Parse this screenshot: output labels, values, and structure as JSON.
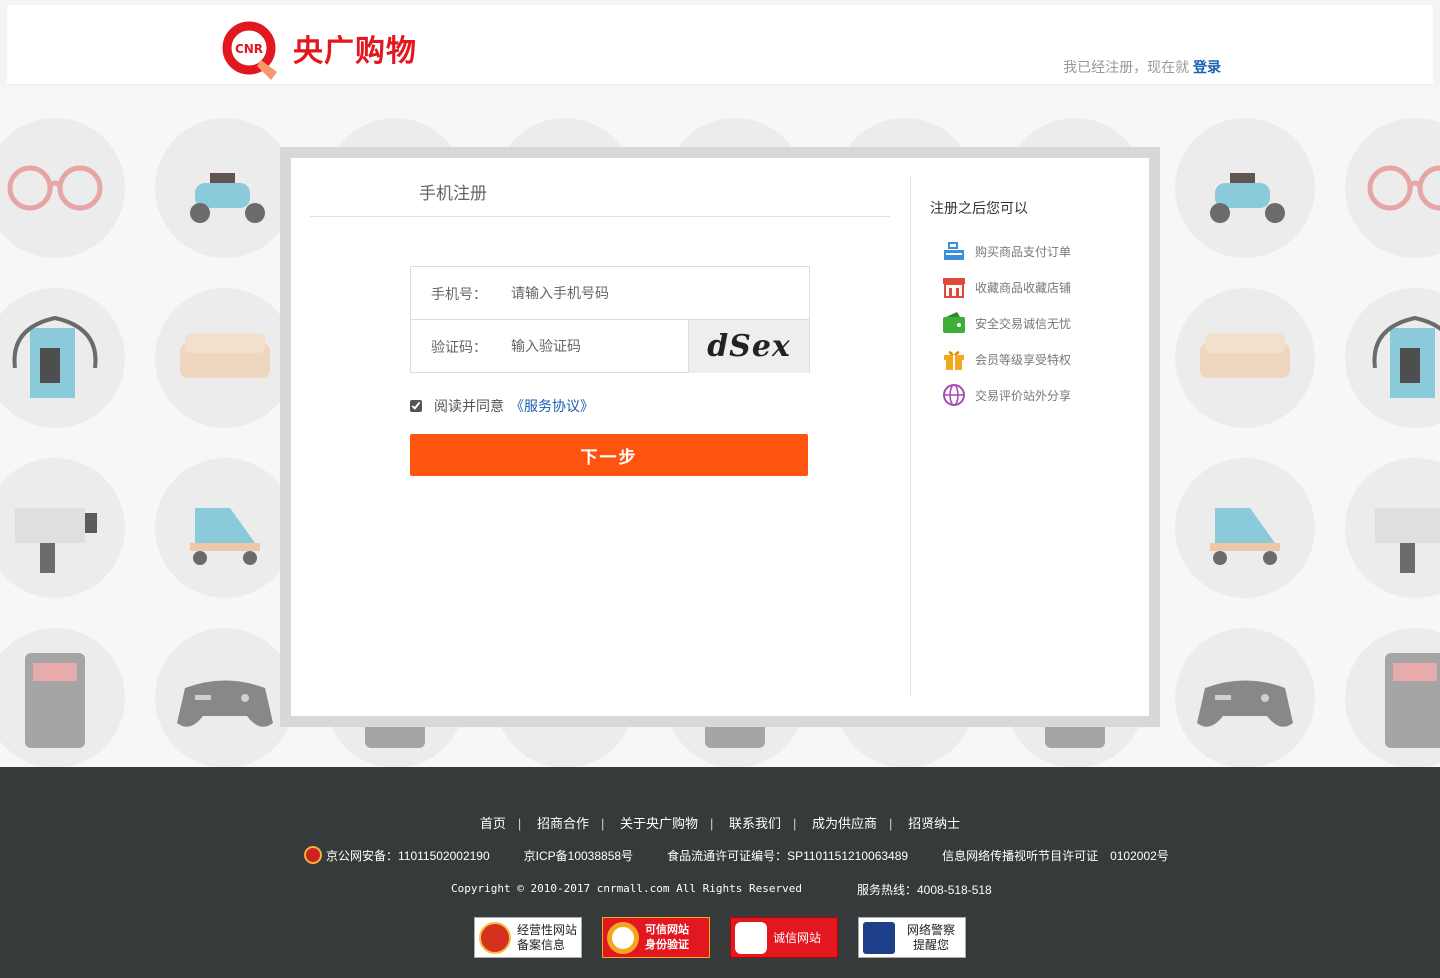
{
  "header": {
    "logo_badge": "CNR",
    "logo_text": "央广购物",
    "login_prefix": "我已经注册，现在就",
    "login_link": "登录"
  },
  "form": {
    "title": "手机注册",
    "phone_label": "手机号：",
    "phone_placeholder": "请输入手机号码",
    "code_label": "验证码：",
    "code_placeholder": "输入验证码",
    "captcha_text": "dSex",
    "agree_text": "阅读并同意",
    "agree_link": "《服务协议》",
    "agree_checked": true,
    "next_button": "下一步"
  },
  "side": {
    "title": "注册之后您可以",
    "benefits": [
      {
        "label": "购买商品支付订单",
        "icon": "cash-register-icon",
        "color": "#3a8fd8"
      },
      {
        "label": "收藏商品收藏店铺",
        "icon": "store-icon",
        "color": "#e0483c"
      },
      {
        "label": "安全交易诚信无忧",
        "icon": "wallet-icon",
        "color": "#3db03a"
      },
      {
        "label": "会员等级享受特权",
        "icon": "gift-icon",
        "color": "#f2a81c"
      },
      {
        "label": "交易评价站外分享",
        "icon": "share-globe-icon",
        "color": "#a24bb5"
      }
    ]
  },
  "footer": {
    "links": [
      "首页",
      "招商合作",
      "关于央广购物",
      "联系我们",
      "成为供应商",
      "招贤纳士"
    ],
    "police_record": "京公网安备：11011502002190",
    "icp": "京ICP备10038858号",
    "food_license": "食品流通许可证编号：SP1101151210063489",
    "av_license": "信息网络传播视听节目许可证　0102002号",
    "copyright": "Copyright © 2010-2017  cnrmall.com  All  Rights  Reserved",
    "hotline": "服务热线：4008-518-518",
    "badges": [
      "经营性网站 备案信息",
      "可信网站 身份验证",
      "诚信网站",
      "网络警察 提醒您"
    ]
  }
}
